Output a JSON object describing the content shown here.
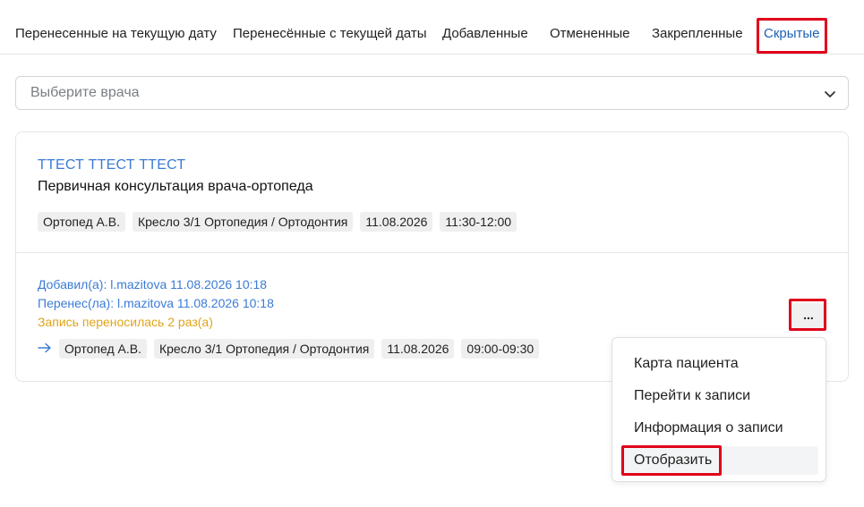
{
  "tabs": [
    {
      "label": "Перенесенные на текущую дату"
    },
    {
      "label": "Перенесённые с текущей даты"
    },
    {
      "label": "Добавленные"
    },
    {
      "label": "Отмененные"
    },
    {
      "label": "Закрепленные"
    },
    {
      "label": "Скрытые",
      "active": true
    }
  ],
  "doctor_select": {
    "placeholder": "Выберите врача"
  },
  "appointment": {
    "patient_name": "ТТЕСТ ТТЕСТ ТТЕСТ",
    "service": "Первичная консультация врача-ортопеда",
    "current": {
      "doctor": "Ортопед А.В.",
      "chair": "Кресло 3/1 Ортопедия / Ортодонтия",
      "date": "11.08.2026",
      "time": "11:30-12:00"
    },
    "added_by": "Добавил(а): l.mazitova 11.08.2026 10:18",
    "moved_by": "Перенес(ла): l.mazitova 11.08.2026 10:18",
    "moved_count": "Запись переносилась 2 раз(а)",
    "previous": {
      "doctor": "Ортопед А.В.",
      "chair": "Кресло 3/1 Ортопедия / Ортодонтия",
      "date": "11.08.2026",
      "time": "09:00-09:30"
    },
    "more_label": "..."
  },
  "context_menu": {
    "items": [
      {
        "label": "Карта пациента"
      },
      {
        "label": "Перейти к записи"
      },
      {
        "label": "Информация о записи"
      },
      {
        "label": "Отобразить"
      }
    ]
  },
  "colors": {
    "link": "#3b7bd4",
    "active_tab": "#1e5fb4",
    "warning": "#e0a419",
    "highlight": "#e0001a"
  }
}
